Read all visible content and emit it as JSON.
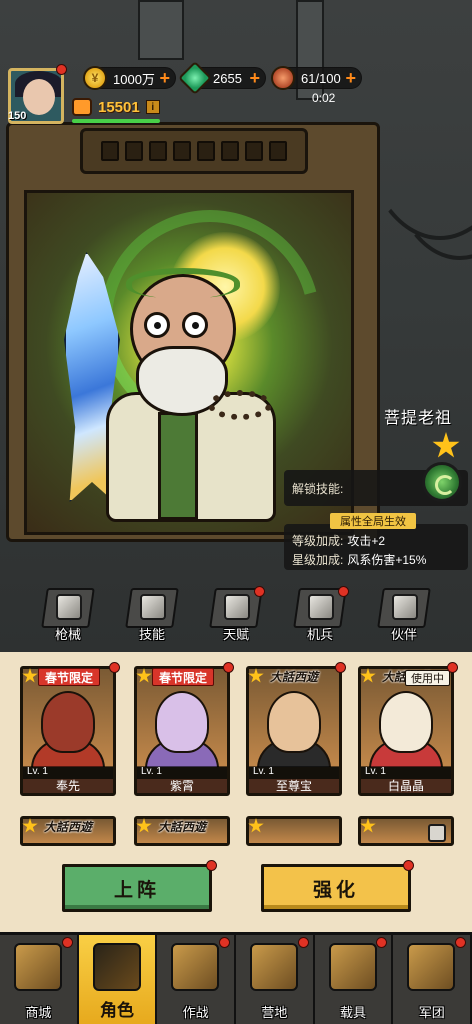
{
  "player": {
    "level": "150",
    "power": "15501",
    "power_info_glyph": "i",
    "power_bar_fraction": 1.0
  },
  "resources": {
    "gold": "1000万",
    "gems": "2655",
    "stamina": "61/100",
    "stamina_timer": "0:02",
    "plus_glyph": "+"
  },
  "hero": {
    "name": "菩提老祖",
    "stars": 1,
    "unlock_skill_label": "解锁技能:",
    "bonus_tag": "属性全局生效",
    "level_bonus_label": "等级加成:",
    "level_bonus_value": "攻击+2",
    "star_bonus_label": "星级加成:",
    "star_bonus_value": "风系伤害+15%"
  },
  "upgrade_tabs": [
    {
      "label": "枪械",
      "icon": "gun-icon"
    },
    {
      "label": "技能",
      "icon": "skill-arrows-icon"
    },
    {
      "label": "天赋",
      "icon": "talent-nodes-icon"
    },
    {
      "label": "机兵",
      "icon": "mech-robot-icon"
    },
    {
      "label": "伙伴",
      "icon": "partner-armor-icon"
    }
  ],
  "cards_row1": [
    {
      "tag": "春节限定",
      "tag_style": "spring",
      "level": "Lv. 1",
      "name": "奉先",
      "art": "#9b3a2a",
      "body": "#b23a28"
    },
    {
      "tag": "春节限定",
      "tag_style": "spring",
      "level": "Lv. 1",
      "name": "紫霄",
      "art": "#d9c0e8",
      "body": "#8a6ab8"
    },
    {
      "tag": "大話西遊",
      "tag_style": "xy",
      "level": "Lv. 1",
      "name": "至尊宝",
      "art": "#e7c29a",
      "body": "#2a2a2a"
    },
    {
      "tag": "大話西遊",
      "tag_style": "xy",
      "level": "Lv. 1",
      "name": "白晶晶",
      "art": "#f3ead8",
      "body": "#c83a3a",
      "status": "使用中"
    }
  ],
  "cards_row2": [
    {
      "tag": "大話西遊",
      "tag_style": "xy"
    },
    {
      "tag": "大話西遊",
      "tag_style": "xy"
    },
    {
      "tag": "",
      "tag_style": ""
    },
    {
      "tag": "",
      "tag_style": "",
      "locked": true
    }
  ],
  "actions": {
    "deploy": "上阵",
    "enhance": "强化"
  },
  "nav": [
    {
      "label": "商城",
      "icon": "shop-cart-icon"
    },
    {
      "label": "角色",
      "icon": "character-icon",
      "active": true
    },
    {
      "label": "作战",
      "icon": "battle-crossed-guns-icon"
    },
    {
      "label": "营地",
      "icon": "camp-tent-icon"
    },
    {
      "label": "载具",
      "icon": "vehicle-crane-icon"
    },
    {
      "label": "军团",
      "icon": "legion-emblem-icon"
    }
  ],
  "colors": {
    "accent_gold": "#f3c24a",
    "deploy_green": "#5bae6a",
    "notification_red": "#e03224",
    "power_orange": "#ffc23a"
  }
}
